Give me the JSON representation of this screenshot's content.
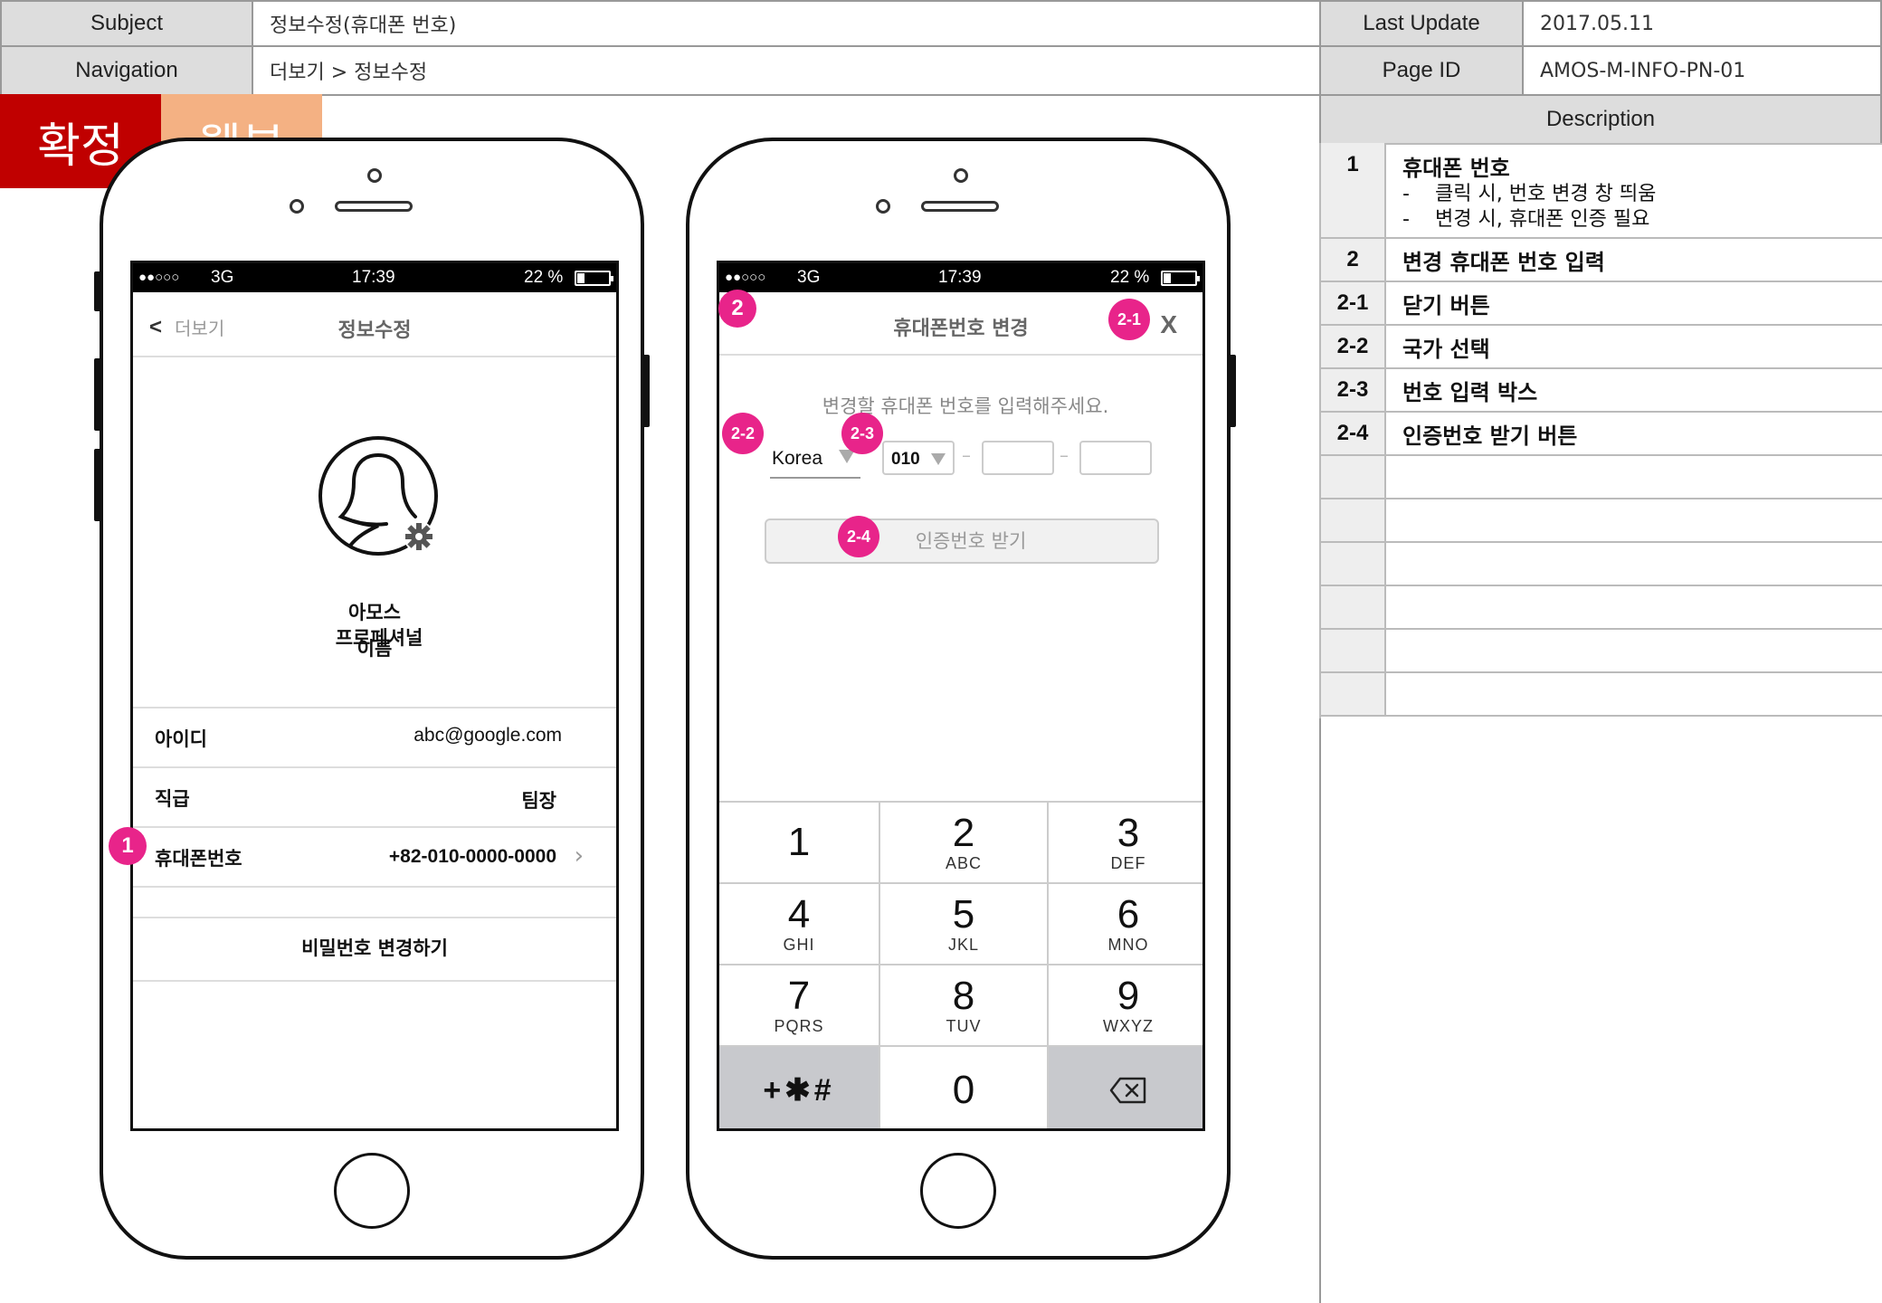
{
  "header": {
    "subject_label": "Subject",
    "subject_value": "정보수정(휴대폰 번호)",
    "navigation_label": "Navigation",
    "navigation_value": "더보기 > 정보수정",
    "last_update_label": "Last Update",
    "last_update_value": "2017.05.11",
    "page_id_label": "Page ID",
    "page_id_value": "AMOS-M-INFO-PN-01",
    "description_label": "Description"
  },
  "stamps": {
    "confirmed": "확정",
    "webview": "웹뷰",
    "confirmed_color": "#c00000",
    "webview_color": "#f4b183"
  },
  "status_bar": {
    "signal": "●●○○○",
    "network": "3G",
    "time": "17:39",
    "battery": "22 %"
  },
  "phone1": {
    "back_label": "더보기",
    "title": "정보수정",
    "profile_name_line1": "아모스",
    "profile_name_line2": "프로페셔널",
    "profile_name_overlap": "이름",
    "rows": [
      {
        "label": "아이디",
        "value": "abc@google.com"
      },
      {
        "label": "직급",
        "value": "팀장"
      },
      {
        "label": "휴대폰번호",
        "value": "+82-010-0000-0000"
      }
    ],
    "password_button": "비밀번호 변경하기",
    "badge": "1"
  },
  "phone2": {
    "title": "휴대폰번호 변경",
    "close": "X",
    "instruction": "변경할 휴대폰 번호를 입력해주세요.",
    "country": "Korea",
    "prefix": "010",
    "dash": "–",
    "verify_button": "인증번호 받기",
    "badges": {
      "screen": "2",
      "close": "2-1",
      "country": "2-2",
      "number": "2-3",
      "verify": "2-4"
    },
    "keys": [
      {
        "num": "1",
        "sub": ""
      },
      {
        "num": "2",
        "sub": "ABC"
      },
      {
        "num": "3",
        "sub": "DEF"
      },
      {
        "num": "4",
        "sub": "GHI"
      },
      {
        "num": "5",
        "sub": "JKL"
      },
      {
        "num": "6",
        "sub": "MNO"
      },
      {
        "num": "7",
        "sub": "PQRS"
      },
      {
        "num": "8",
        "sub": "TUV"
      },
      {
        "num": "9",
        "sub": "WXYZ"
      },
      {
        "num": "+✱#",
        "sub": ""
      },
      {
        "num": "0",
        "sub": ""
      },
      {
        "num": "",
        "sub": ""
      }
    ]
  },
  "description": {
    "rows": [
      {
        "num": "1",
        "title": "휴대폰 번호",
        "bullets": [
          "클릭 시, 번호 변경 창 띄움",
          "변경 시, 휴대폰 인증 필요"
        ]
      },
      {
        "num": "2",
        "title": "변경 휴대폰 번호 입력"
      },
      {
        "num": "2-1",
        "title": "닫기 버튼"
      },
      {
        "num": "2-2",
        "title": "국가 선택"
      },
      {
        "num": "2-3",
        "title": "번호 입력 박스"
      },
      {
        "num": "2-4",
        "title": "인증번호 받기 버튼"
      }
    ],
    "bullet_marker": "-"
  },
  "icons": {
    "back": "chevron-left-icon",
    "chevron": "chevron-right-icon",
    "settings": "gear-icon",
    "profile": "avatar-icon",
    "backspace": "backspace-icon",
    "dropdown": "triangle-down-icon"
  }
}
